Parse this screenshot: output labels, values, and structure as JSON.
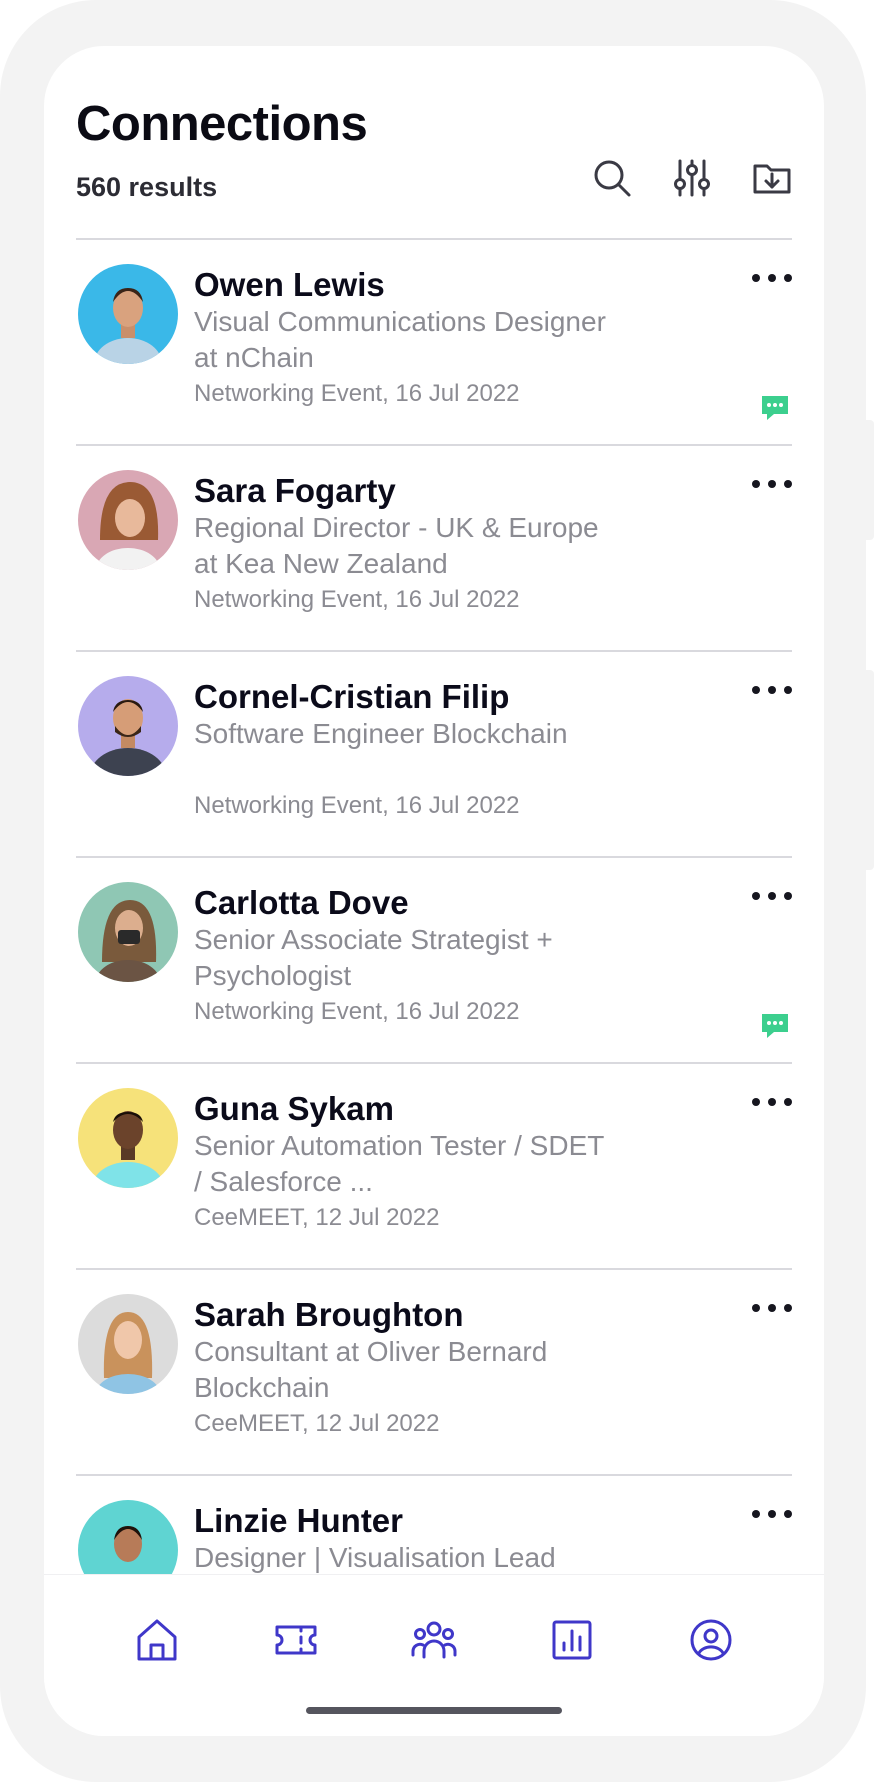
{
  "header": {
    "title": "Connections",
    "results": "560 results"
  },
  "toolbar": {
    "search_icon": "search-icon",
    "filter_icon": "sliders-icon",
    "export_icon": "folder-download-icon"
  },
  "colors": {
    "accent": "#3f37c9",
    "chat_badge": "#3ccf8e",
    "title_text": "#0b0b1a",
    "secondary_text": "#8b8b92"
  },
  "connections": [
    {
      "name": "Owen Lewis",
      "title": "Visual Communications Designer at nChain",
      "meta": "Networking Event, 16 Jul 2022",
      "has_chat": true,
      "avatar_bg": "#3ab8e8"
    },
    {
      "name": "Sara Fogarty",
      "title": "Regional Director - UK & Europe at Kea New Zealand",
      "meta": "Networking Event, 16 Jul 2022",
      "has_chat": false,
      "avatar_bg": "#d9a7b4"
    },
    {
      "name": "Cornel-Cristian Filip",
      "title": "Software Engineer Blockchain",
      "meta": "Networking Event, 16 Jul 2022",
      "has_chat": false,
      "avatar_bg": "#b6acec"
    },
    {
      "name": "Carlotta Dove",
      "title": "Senior Associate Strategist + Psychologist",
      "meta": "Networking Event, 16 Jul 2022",
      "has_chat": true,
      "avatar_bg": "#8fc7b4"
    },
    {
      "name": "Guna Sykam",
      "title": "Senior Automation Tester / SDET / Salesforce ...",
      "meta": "CeeMEET, 12 Jul 2022",
      "has_chat": false,
      "avatar_bg": "#f6e27a"
    },
    {
      "name": "Sarah Broughton",
      "title": "Consultant at Oliver Bernard Blockchain",
      "meta": "CeeMEET, 12 Jul 2022",
      "has_chat": false,
      "avatar_bg": "#dcdcdc"
    },
    {
      "name": "Linzie Hunter",
      "title": "Designer | Visualisation Lead",
      "meta": "",
      "has_chat": false,
      "avatar_bg": "#5fd4d2"
    }
  ],
  "bottom_nav": [
    {
      "icon": "home-icon"
    },
    {
      "icon": "ticket-icon"
    },
    {
      "icon": "people-icon"
    },
    {
      "icon": "chart-icon"
    },
    {
      "icon": "profile-icon"
    }
  ]
}
